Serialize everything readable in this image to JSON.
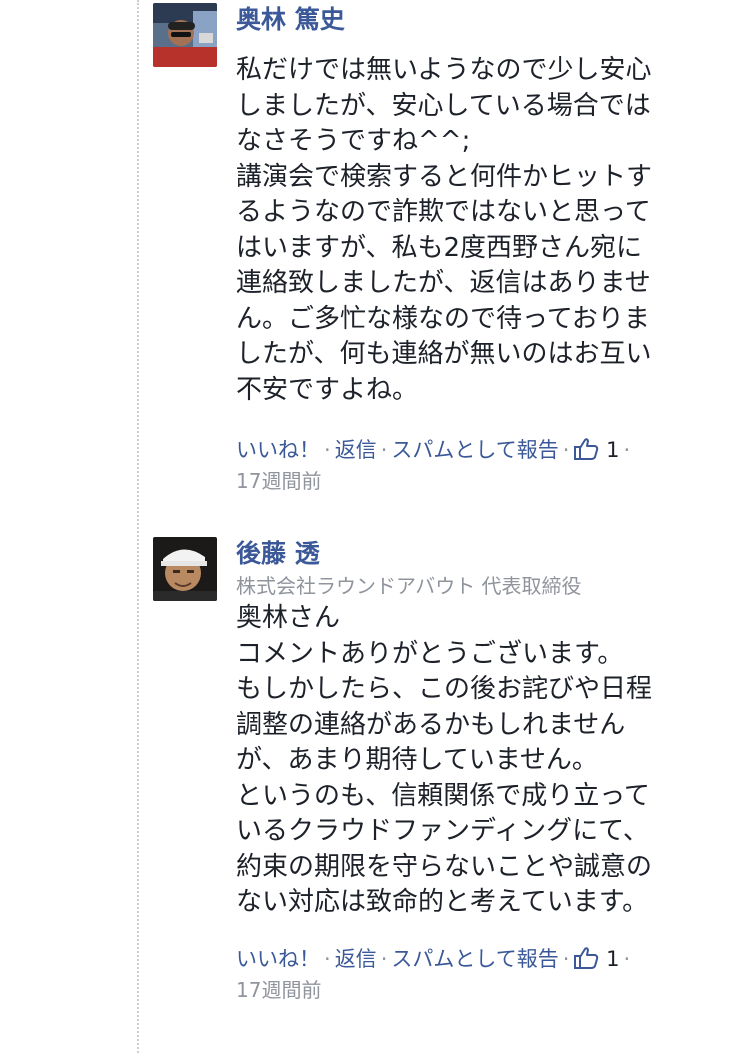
{
  "comments": [
    {
      "author": "奥林 篤史",
      "subtitle": "",
      "lines": [
        "私だけでは無いようなので少し安心",
        "しましたが、安心している場合では",
        "なさそうですね^^;",
        "講演会で検索すると何件かヒットす",
        "るようなので詐欺ではないと思って",
        "はいますが、私も2度西野さん宛に",
        "連絡致しましたが、返信はありませ",
        "ん。ご多忙な様なので待っておりま",
        "したが、何も連絡が無いのはお互い",
        "不安ですよね。"
      ],
      "like_label": "いいね！",
      "reply_label": "返信",
      "spam_label": "スパムとして報告",
      "like_count": "1",
      "separator": "·",
      "timestamp": "17週間前",
      "avatar_icon": "user-avatar-photo"
    },
    {
      "author": "後藤 透",
      "subtitle": "株式会社ラウンドアバウト 代表取締役",
      "lines": [
        "奥林さん",
        "コメントありがとうございます。",
        "もしかしたら、この後お詫びや日程",
        "調整の連絡があるかもしれません",
        "が、あまり期待していません。",
        "というのも、信頼関係で成り立って",
        "いるクラウドファンディングにて、",
        "約束の期限を守らないことや誠意の",
        "ない対応は致命的と考えています。"
      ],
      "like_label": "いいね！",
      "reply_label": "返信",
      "spam_label": "スパムとして報告",
      "like_count": "1",
      "separator": "·",
      "timestamp": "17週間前",
      "avatar_icon": "user-avatar-photo"
    }
  ],
  "colors": {
    "link": "#3b5998",
    "text": "#1d2129",
    "muted": "#90949c"
  },
  "icons": {
    "like": "thumbs-up-icon"
  }
}
